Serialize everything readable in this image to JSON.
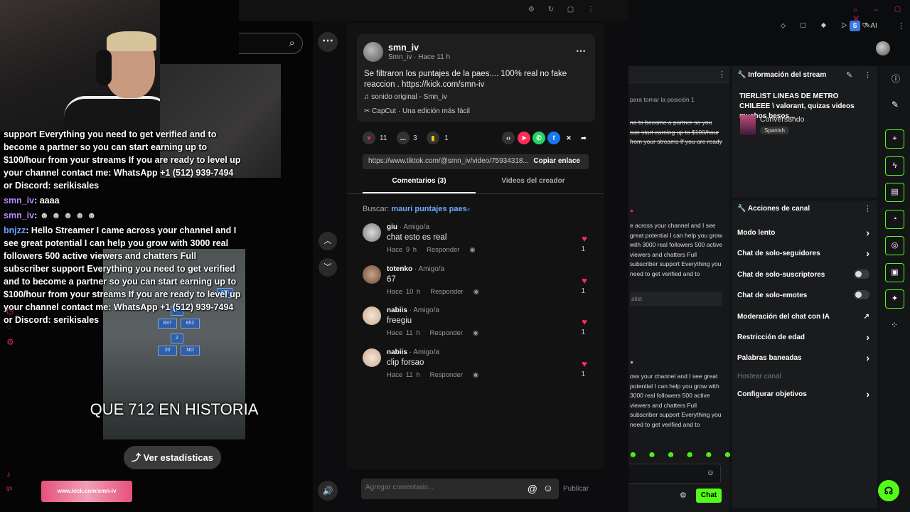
{
  "stream": {
    "chat_lines": [
      {
        "user": "",
        "text": "support Everything you need to get verified and to become a partner so you can start earning up to $100/hour from your streams If you are ready to level up your channel contact me: WhatsApp +1 (512) 939-7494 or Discord: serikisales"
      },
      {
        "user": "smn_iv",
        "text": ": aaaa"
      },
      {
        "user": "smn_iv",
        "text": ":"
      },
      {
        "user": "bnjzz",
        "text": ": Hello Streamer I came across your channel and I see great potential I can help you grow with 3000 real followers 500 active viewers and chatters Full subscriber support Everything you need to get verified and to become a partner so you can start earning up to $100/hour from your streams If you are ready to level up your channel contact me: WhatsApp +1 (512) 939-7494 or Discord: serikisales"
      }
    ],
    "video_caption": "QUE 712 EN HISTORIA",
    "video_boxes": [
      "418",
      "2",
      "837",
      "852",
      "2",
      "20",
      "NO"
    ],
    "stats_label": "Ver estadísticas",
    "banner_text": "www.kick.com/smn-iv",
    "side_labels": [
      "gx"
    ]
  },
  "tiktok": {
    "author": "smn_iv",
    "author_sub": "Smn_iv · Hace 11 h",
    "caption": "Se filtraron los puntajes de la paes.... 100% real no fake reaccion . https://kick.com/smn-iv",
    "sound": "sonido original - Smn_iv",
    "capcut": "CapCut · Una edición más fácil",
    "likes": "11",
    "comments_count": "3",
    "saves": "1",
    "link": "https://www.tiktok.com/@smn_iv/video/75934318...",
    "copy_label": "Copiar enlace",
    "tab_comments": "Comentarios (3)",
    "tab_videos": "Videos del creador",
    "search_prefix": "Buscar:",
    "search_term": "mauri puntajes paes",
    "comments": [
      {
        "name": "giu",
        "tag": " · Amigo/a",
        "text": "chat esto es real",
        "time": "Hace 9 h",
        "reply": "Responder",
        "likes": "1"
      },
      {
        "name": "totenko",
        "tag": " · Amigo/a",
        "text": "67",
        "time": "Hace 10 h",
        "reply": "Responder",
        "likes": "1"
      },
      {
        "name": "nabiis",
        "tag": " · Amigo/a",
        "text": "freegiu",
        "time": "Hace 11 h",
        "reply": "Responder",
        "likes": "1"
      },
      {
        "name": "nabiis",
        "tag": " · Amigo/a",
        "text": "clip forsao",
        "time": "Hace 11 h",
        "reply": "Responder",
        "likes": "1"
      }
    ],
    "comment_placeholder": "Agregar comentario...",
    "publish_label": "Publicar"
  },
  "kick": {
    "browser_badge": "S",
    "ai_label": "AI",
    "chat_notice": "para tomar la posición 1",
    "chat_block1": "no to become a partner so you can start earning up to $100/hour from your streams If you are ready to level up your channel contact me: WhatsApp +1 (512) 939-7494 or Discord: serikisales",
    "chat_block2": "e across your channel and I see great potential I can help you grow with 3000 real followers 500 active viewers and chatters Full subscriber support Everything you need to get verified and to become a partner so you can start earning up to $100/hour from your streams If you are ready to level up your channel contact me: WhatsApp +1 (512) 939-7494 or",
    "chat_tag": "alist",
    "chat_block3": "oss your channel and I see great potential I can help you grow with 3000 real followers 500 active viewers and chatters Full subscriber support Everything you need to get verified and to become a partner so you can start earning up to $100/hour from your streams If you are ready to level up your channel contact me: WhatsApp +1 (512) 939-7494 or",
    "chat_button": "Chat",
    "stream_info_title": "Información del stream",
    "stream_title": "TIERLIST LINEAS DE METRO CHILEEE \\ valorant, quizas videos muchos besos...",
    "category": "Conversando",
    "language": "Spanish",
    "channel_actions_title": "Acciones de canal",
    "menu": [
      {
        "label": "Modo lento",
        "control": "chevron"
      },
      {
        "label": "Chat de solo-seguidores",
        "control": "chevron"
      },
      {
        "label": "Chat de solo-suscriptores",
        "control": "toggle"
      },
      {
        "label": "Chat de solo-emotes",
        "control": "toggle"
      },
      {
        "label": "Moderación del chat con IA",
        "control": "external"
      },
      {
        "label": "Restricción de edad",
        "control": "chevron"
      },
      {
        "label": "Palabras baneadas",
        "control": "chevron"
      },
      {
        "label": "Hostear canal",
        "control": "none"
      },
      {
        "label": "Configurar objetivos",
        "control": "chevron"
      }
    ],
    "accent": "#53fc18"
  }
}
